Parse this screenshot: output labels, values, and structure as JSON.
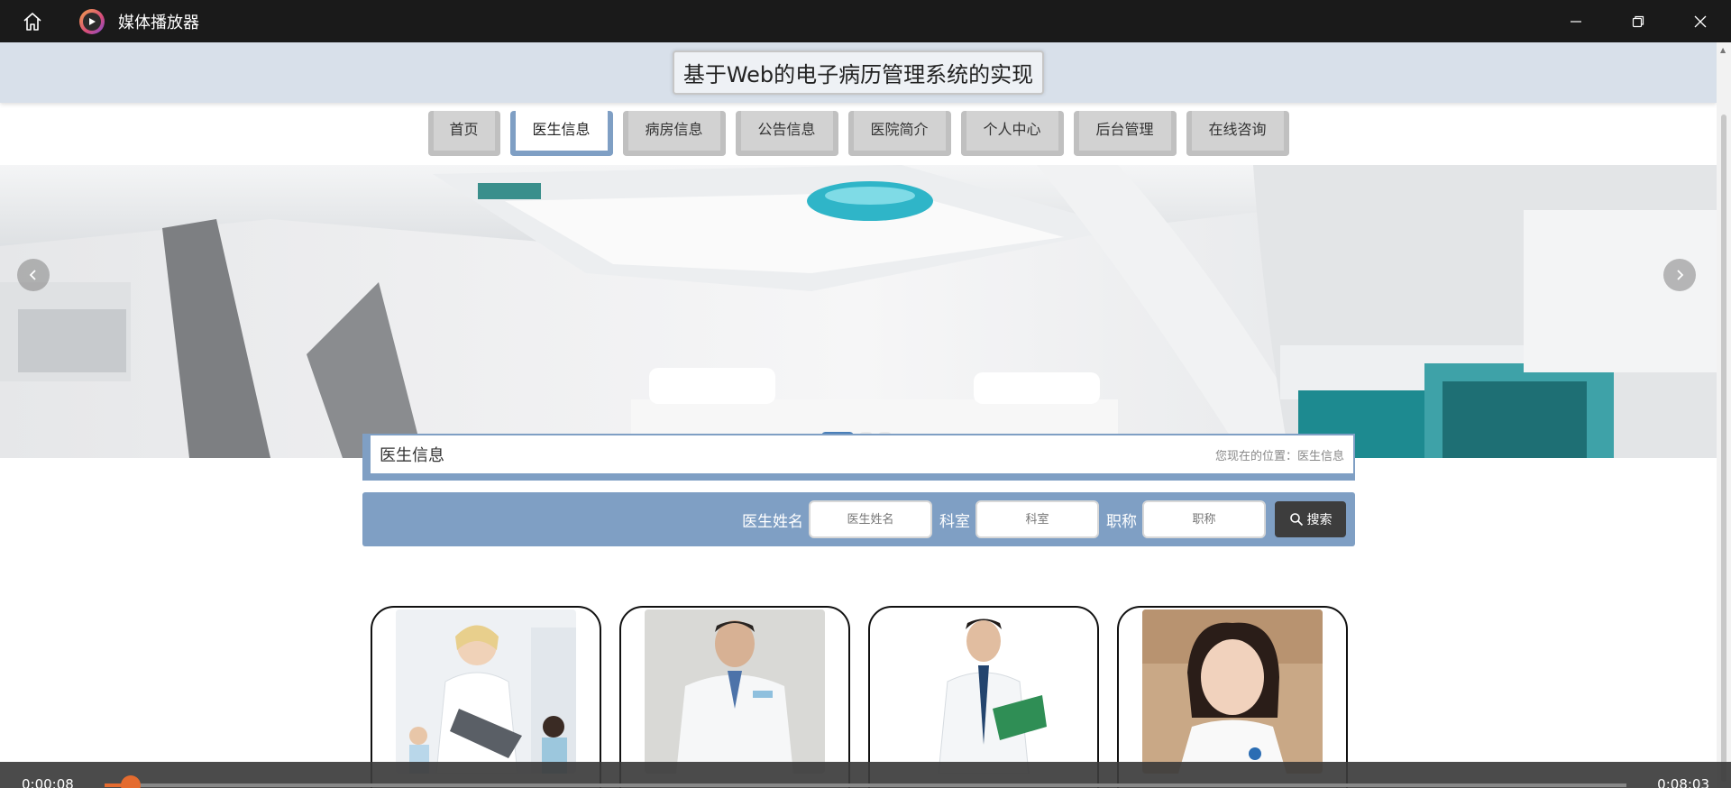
{
  "window": {
    "title": "媒体播放器",
    "controls": [
      "minimize-icon",
      "restore-icon",
      "close-icon"
    ]
  },
  "site": {
    "title": "基于Web的电子病历管理系统的实现",
    "nav": [
      {
        "label": "首页",
        "active": false
      },
      {
        "label": "医生信息",
        "active": true
      },
      {
        "label": "病房信息",
        "active": false
      },
      {
        "label": "公告信息",
        "active": false
      },
      {
        "label": "医院简介",
        "active": false
      },
      {
        "label": "个人中心",
        "active": false
      },
      {
        "label": "后台管理",
        "active": false
      },
      {
        "label": "在线咨询",
        "active": false
      }
    ],
    "carousel": {
      "slide_count": 3,
      "active_index": 0
    }
  },
  "content": {
    "section_title": "医生信息",
    "location": "您现在的位置：医生信息",
    "search": {
      "name_label": "医生姓名",
      "name_placeholder": "医生姓名",
      "dept_label": "科室",
      "dept_placeholder": "科室",
      "title_label": "职称",
      "title_placeholder": "职称",
      "button_label": "搜索"
    }
  },
  "player": {
    "current_time": "0:00:08",
    "total_time": "0:08:03",
    "progress_fraction": 0.017
  },
  "colors": {
    "accent": "#7f9fc4",
    "progress": "#e46b2f",
    "titlebar": "#1a1a1a"
  }
}
